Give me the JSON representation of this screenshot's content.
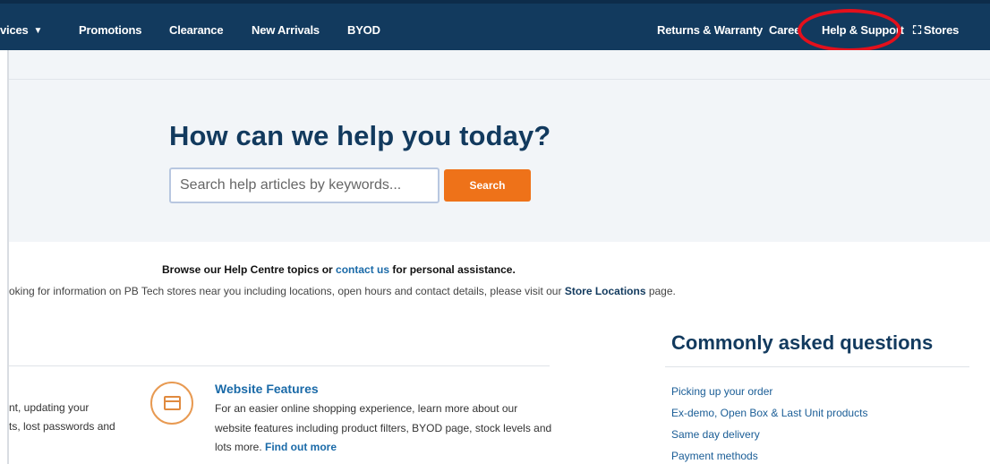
{
  "nav": {
    "items_left": [
      {
        "label": "vices",
        "has_chevron": true
      },
      {
        "label": "Promotions"
      },
      {
        "label": "Clearance"
      },
      {
        "label": "New Arrivals"
      },
      {
        "label": "BYOD"
      }
    ],
    "items_right": [
      {
        "label": "Returns & Warranty"
      },
      {
        "label": "Caree"
      },
      {
        "label": "Help & Support"
      },
      {
        "label": "Stores",
        "icon": "store-icon"
      }
    ],
    "chevron_glyph": "▼",
    "stores_glyph": "⛶"
  },
  "hero": {
    "title": "How can we help you today?",
    "search_placeholder": "Search help articles by keywords...",
    "search_button": "Search"
  },
  "browse": {
    "prefix": "Browse our Help Centre topics or ",
    "link": "contact us",
    "suffix": " for personal assistance."
  },
  "stores_info": {
    "prefix": "oking for information on PB Tech stores near you including locations, open hours and contact details, please visit our ",
    "link": "Store Locations",
    "suffix": " page."
  },
  "topics": {
    "left_lines": [
      "nt, updating your",
      "ts, lost passwords and"
    ],
    "website_features": {
      "title": "Website Features",
      "description": "For an easier online shopping experience, learn more about our website features including product filters, BYOD page, stock levels and lots more. ",
      "link": "Find out more"
    }
  },
  "faq": {
    "title": "Commonly asked questions",
    "items": [
      "Picking up your order",
      "Ex-demo, Open Box & Last Unit products",
      "Same day delivery",
      "Payment methods"
    ]
  },
  "colors": {
    "nav_bg": "#123a5e",
    "accent_orange": "#ee7219",
    "link_blue": "#1a6aa8",
    "highlight_red": "#e3101c"
  }
}
